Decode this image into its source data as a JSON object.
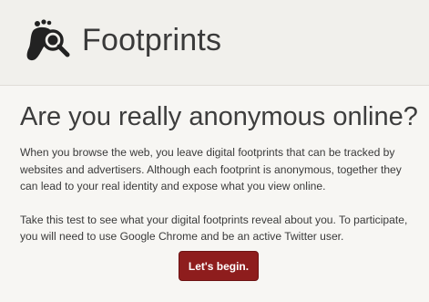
{
  "header": {
    "brand": "Footprints",
    "logo_icon": "footprint-magnifier-icon"
  },
  "main": {
    "headline": "Are you really anonymous online?",
    "paragraph1": "When you browse the web, you leave digital footprints that can be tracked by websites and advertisers. Although each footprint is anonymous, together they can lead to your real identity and expose what you view online.",
    "paragraph2": "Take this test to see what your digital footprints reveal about you. To participate, you will need to use Google Chrome and be an active Twitter user.",
    "cta_label": "Let's begin."
  },
  "colors": {
    "header_bg": "#f1f0ec",
    "page_bg": "#f7f6f3",
    "button_bg": "#8e1d1d",
    "text": "#333333"
  }
}
